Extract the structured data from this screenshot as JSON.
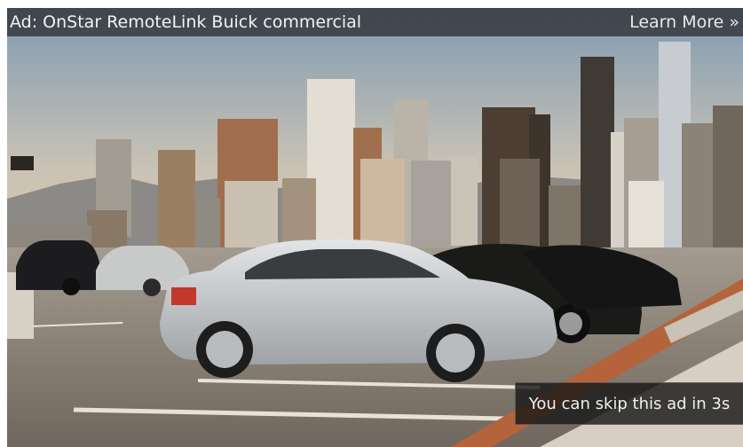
{
  "ad": {
    "title": "Ad: OnStar RemoteLink Buick commercial",
    "learn_more": "Learn More »"
  },
  "skip": {
    "text": "You can skip this ad in 3s"
  },
  "colors": {
    "ad_bar": "#3c4046",
    "sky_top": "#8aa3b8",
    "sky_bottom": "#d9c7a8",
    "ground": "#8a8378",
    "car_silver": "#c9cbcd",
    "car_black": "#1c1c1c",
    "railing": "#b8643d"
  }
}
